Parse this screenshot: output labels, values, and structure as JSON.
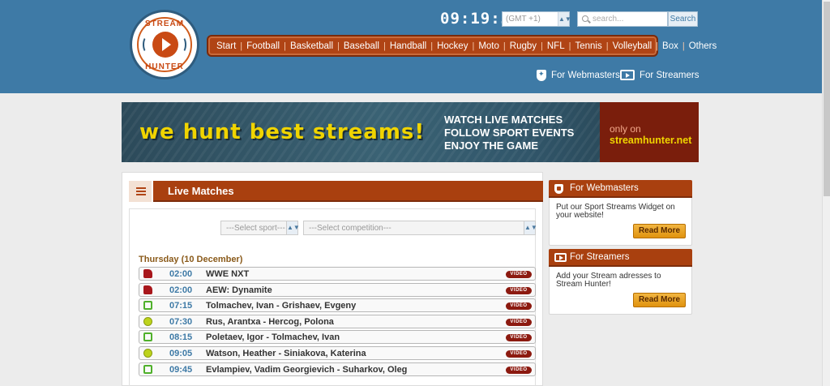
{
  "logo": {
    "top_text": "STREAM",
    "bottom_text": "HUNTER"
  },
  "header": {
    "clock": "09:19:33",
    "timezone": "(GMT +1)",
    "search_placeholder": "search...",
    "search_button": "Search",
    "nav": [
      "Start",
      "Football",
      "Basketball",
      "Baseball",
      "Handball",
      "Hockey",
      "Moto",
      "Rugby",
      "NFL",
      "Tennis",
      "Volleyball",
      "Box",
      "Others"
    ],
    "webmasters_link": "For Webmasters",
    "streamers_link": "For Streamers"
  },
  "banner": {
    "slogan": "we hunt best streams!",
    "line1": "WATCH LIVE MATCHES",
    "line2": "FOLLOW SPORT EVENTS",
    "line3": "ENJOY THE GAME",
    "only_on": "only on",
    "site": "streamhunter.net"
  },
  "live": {
    "title": "Live Matches",
    "select_sport": "---Select sport---",
    "select_competition": "---Select competition---",
    "day": "Thursday (10 December)",
    "video_label": "VIDEO",
    "matches": [
      {
        "icon": "boxing-glove-icon",
        "time": "02:00",
        "name": "WWE NXT"
      },
      {
        "icon": "boxing-glove-icon",
        "time": "02:00",
        "name": "AEW: Dynamite"
      },
      {
        "icon": "tv-icon",
        "time": "07:15",
        "name": "Tolmachev, Ivan - Grishaev, Evgeny"
      },
      {
        "icon": "tennis-ball-icon",
        "time": "07:30",
        "name": "Rus, Arantxa - Hercog, Polona"
      },
      {
        "icon": "tv-icon",
        "time": "08:15",
        "name": "Poletaev, Igor - Tolmachev, Ivan"
      },
      {
        "icon": "tennis-ball-icon",
        "time": "09:05",
        "name": "Watson, Heather - Siniakova, Katerina"
      },
      {
        "icon": "tv-icon",
        "time": "09:45",
        "name": "Evlampiev, Vadim Georgievich - Suharkov, Oleg"
      }
    ]
  },
  "side": {
    "webmasters": {
      "title": "For Webmasters",
      "text": "Put our Sport Streams Widget on your website!",
      "button": "Read More"
    },
    "streamers": {
      "title": "For Streamers",
      "text": "Add your Stream adresses to Stream Hunter!",
      "button": "Read More"
    }
  },
  "colors": {
    "header": "#3e7aa6",
    "accent": "#a9400f",
    "nav": "#b04415",
    "button": "#e0930e"
  }
}
